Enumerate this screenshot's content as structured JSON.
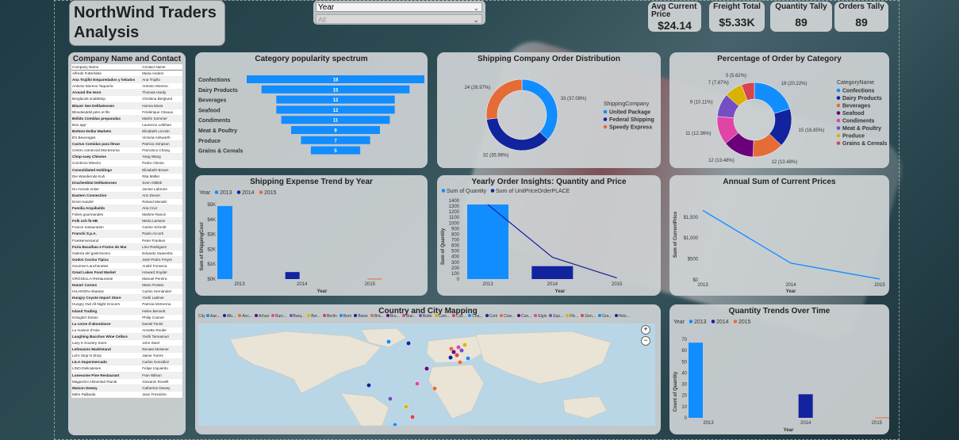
{
  "header": {
    "title": "NorthWind Traders Analysis"
  },
  "slicer": {
    "label": "Year",
    "value": "All"
  },
  "kpis": [
    {
      "title": "Avg Current Price",
      "value": "$24.14"
    },
    {
      "title": "Freight Total",
      "value": "$5.33K"
    },
    {
      "title": "Quantity Tally",
      "value": "89"
    },
    {
      "title": "Orders Tally",
      "value": "89"
    }
  ],
  "company_table": {
    "title": "Company Name and Contact",
    "columns": [
      "Company Name",
      "Contact Name"
    ],
    "rows": [
      [
        "Alfreds Futterkiste",
        "Maria Anders"
      ],
      [
        "Ana Trujillo Emparedados y helados",
        "Ana Trujillo"
      ],
      [
        "Antonio Moreno Taquería",
        "Antonio Moreno"
      ],
      [
        "Around the Horn",
        "Thomas Hardy"
      ],
      [
        "Berglunds snabbköp",
        "Christina Berglund"
      ],
      [
        "Blauer See Delikatessen",
        "Hanna Moos"
      ],
      [
        "Blondesddsl père et fils",
        "Frédérique Citeaux"
      ],
      [
        "Bólido Comidas preparadas",
        "Martín Sommer"
      ],
      [
        "Bon app'",
        "Laurence Lebihan"
      ],
      [
        "Bottom-Dollar Markets",
        "Elizabeth Lincoln"
      ],
      [
        "B's Beverages",
        "Victoria Ashworth"
      ],
      [
        "Cactus Comidas para llevar",
        "Patricio Simpson"
      ],
      [
        "Centro comercial Moctezuma",
        "Francisco Chang"
      ],
      [
        "Chop-suey Chinese",
        "Yang Wang"
      ],
      [
        "Comércio Mineiro",
        "Pedro Afonso"
      ],
      [
        "Consolidated Holdings",
        "Elizabeth Brown"
      ],
      [
        "Die Wandernde Kuh",
        "Rita Müller"
      ],
      [
        "Drachenblut Delikatessen",
        "Sven Ottlieb"
      ],
      [
        "Du monde entier",
        "Janine Labrune"
      ],
      [
        "Eastern Connection",
        "Ann Devon"
      ],
      [
        "Ernst Handel",
        "Roland Mendel"
      ],
      [
        "Familia Arquibaldo",
        "Aria Cruz"
      ],
      [
        "Folies gourmandes",
        "Martine Rancé"
      ],
      [
        "Folk och fä HB",
        "Maria Larsson"
      ],
      [
        "France restauration",
        "Carine Schmitt"
      ],
      [
        "Franchi S.p.A.",
        "Paolo Accorti"
      ],
      [
        "Frankenversand",
        "Peter Franken"
      ],
      [
        "Furia Bacalhau e Frutos do Mar",
        "Lino Rodriguez"
      ],
      [
        "Galería del gastrónomo",
        "Eduardo Saavedra"
      ],
      [
        "Godos Cocina Típica",
        "José Pedro Freyre"
      ],
      [
        "Gourmet Lanchonetes",
        "André Fonseca"
      ],
      [
        "Great Lakes Food Market",
        "Howard Snyder"
      ],
      [
        "GROSELLA-Restaurante",
        "Manuel Pereira"
      ],
      [
        "Hanari Carnes",
        "Mario Pontes"
      ],
      [
        "HILARIÓN-Abastos",
        "Carlos Hernández"
      ],
      [
        "Hungry Coyote Import Store",
        "Yoshi Latimer"
      ],
      [
        "Hungry Owl All-Night Grocers",
        "Patricia McKenna"
      ],
      [
        "Island Trading",
        "Helen Bennett"
      ],
      [
        "Königlich Essen",
        "Philip Cramer"
      ],
      [
        "La corne d'abondance",
        "Daniel Tonini"
      ],
      [
        "La maison d'Asie",
        "Annette Roulet"
      ],
      [
        "Laughing Bacchus Wine Cellars",
        "Yoshi Tannamuri"
      ],
      [
        "Lazy K Kountry Store",
        "John Steel"
      ],
      [
        "Lehmanns Marktstand",
        "Renate Messner"
      ],
      [
        "Let's Stop N Shop",
        "Jaime Yorres"
      ],
      [
        "LILA-Supermercado",
        "Carlos González"
      ],
      [
        "LINO-Delicateses",
        "Felipe Izquierdo"
      ],
      [
        "Lonesome Pine Restaurant",
        "Fran Wilson"
      ],
      [
        "Magazzini Alimentari Riuniti",
        "Giovanni Rovelli"
      ],
      [
        "Maison Dewey",
        "Catherine Dewey"
      ],
      [
        "Mère Paillarde",
        "Jean Fresnière"
      ]
    ]
  },
  "panels": {
    "category_popularity": "Category popularity spectrum",
    "shipping_distribution": "Shipping Company Order Distribution",
    "pct_by_category": "Percentage of Order by Category",
    "shipping_expense": "Shipping Expense Trend by Year",
    "yearly_insights": "Yearly Order Insights: Quantity and Price",
    "annual_prices": "Annual Sum of Current Prices",
    "country_map": "Country and City Mapping",
    "quantity_trends": "Quantity Trends Over Time"
  },
  "map": {
    "legend_title": "City",
    "legend_items": [
      "Aac...",
      "Alb...",
      "Anc...",
      "Árhus",
      "Barc...",
      "Barq...",
      "Ber...",
      "Berlin",
      "Bern",
      "Boise",
      "Brä...",
      "Bru...",
      "Bue...",
      "Butte",
      "Cam...",
      "Car...",
      "Cha...",
      "Cork",
      "Cow...",
      "Cun...",
      "Elgin",
      "Esp...",
      "Fle...",
      "Gen...",
      "Gra...",
      "Hels..."
    ]
  },
  "colors": {
    "blue": "#118DFF",
    "navy": "#12239E",
    "orange": "#E66C37",
    "purple": "#6B007B",
    "pink": "#E044A7",
    "violet": "#744EC2",
    "yellow": "#D9B300",
    "red": "#D64550"
  },
  "chart_data": [
    {
      "type": "bar",
      "orientation": "horizontal",
      "title": "Category popularity spectrum",
      "categories": [
        "Confections",
        "Dairy Products",
        "Beverages",
        "Seafood",
        "Condiments",
        "Meat & Poultry",
        "Produce",
        "Grains & Cereals"
      ],
      "values": [
        18,
        15,
        12,
        12,
        11,
        9,
        7,
        5
      ]
    },
    {
      "type": "pie",
      "subtype": "donut",
      "title": "Shipping Company Order Distribution",
      "legend_title": "ShippingCompany",
      "categories": [
        "United Package",
        "Federal Shipping",
        "Speedy Express"
      ],
      "values": [
        33,
        32,
        24
      ],
      "labels": [
        "33 (37.08%)",
        "32 (35.96%)",
        "24 (26.97%)"
      ],
      "colors": [
        "#118DFF",
        "#12239E",
        "#E66C37"
      ]
    },
    {
      "type": "pie",
      "subtype": "donut",
      "title": "Percentage of Order by Category",
      "legend_title": "CategoryName",
      "categories": [
        "Confections",
        "Dairy Products",
        "Beverages",
        "Seafood",
        "Condiments",
        "Meat & Poultry",
        "Produce",
        "Grains & Cereals"
      ],
      "values": [
        18,
        15,
        12,
        12,
        11,
        9,
        7,
        5
      ],
      "labels": [
        "18 (20.22%)",
        "15 (16.85%)",
        "12 (13.48%)",
        "12 (13.48%)",
        "11 (12.36%)",
        "9 (10.11%)",
        "7 (7.87%)",
        "5 (5.62%)"
      ],
      "colors": [
        "#118DFF",
        "#12239E",
        "#E66C37",
        "#6B007B",
        "#E044A7",
        "#744EC2",
        "#D9B300",
        "#D64550"
      ]
    },
    {
      "type": "bar",
      "title": "Shipping Expense Trend by Year",
      "legend_title": "Year",
      "xlabel": "Year",
      "ylabel": "Sum of ShippingCost",
      "categories": [
        "2013",
        "2014",
        "2015"
      ],
      "series": [
        {
          "name": "2013",
          "values": [
            4900,
            0,
            0
          ]
        },
        {
          "name": "2014",
          "values": [
            0,
            470,
            0
          ]
        },
        {
          "name": "2015",
          "values": [
            0,
            0,
            0
          ]
        }
      ],
      "yticks": [
        "$0K",
        "$1K",
        "$2K",
        "$3K",
        "$4K",
        "$5K"
      ],
      "ylim": [
        0,
        5000
      ]
    },
    {
      "type": "bar",
      "subtype": "combo",
      "title": "Yearly Order Insights: Quantity and Price",
      "xlabel": "Year",
      "ylabel": "Sum of Quantity",
      "categories": [
        "2013",
        "2014",
        "2015"
      ],
      "series": [
        {
          "name": "Sum of Quantity",
          "type": "bar",
          "values": [
            1330,
            230,
            0
          ]
        },
        {
          "name": "Sum of UnitPriceOrderPLACE",
          "type": "line",
          "values": [
            1330,
            390,
            20
          ]
        }
      ],
      "yticks": [
        "0",
        "100",
        "200",
        "300",
        "400",
        "500",
        "600",
        "700",
        "800",
        "900",
        "1000",
        "1100",
        "1200",
        "1300",
        "1400"
      ],
      "ylim": [
        0,
        1400
      ]
    },
    {
      "type": "line",
      "title": "Annual Sum of Current Prices",
      "xlabel": "Year",
      "ylabel": "Sum of CurrentPrice",
      "categories": [
        "2013",
        "2014",
        "2015"
      ],
      "series": [
        {
          "name": "Sum of CurrentPrice",
          "values": [
            1660,
            400,
            20
          ]
        }
      ],
      "yticks": [
        "$0",
        "$500",
        "$1,000",
        "$1,500"
      ],
      "ylim": [
        0,
        1800
      ]
    },
    {
      "type": "bar",
      "title": "Quantity Trends Over Time",
      "legend_title": "Year",
      "xlabel": "Year",
      "ylabel": "Count of Quantity",
      "categories": [
        "2013",
        "2014",
        "2015"
      ],
      "series": [
        {
          "name": "2013",
          "values": [
            67,
            0,
            0
          ]
        },
        {
          "name": "2014",
          "values": [
            0,
            21,
            0
          ]
        },
        {
          "name": "2015",
          "values": [
            0,
            0,
            0
          ]
        }
      ],
      "yticks": [
        "0",
        "10",
        "20",
        "30",
        "40",
        "50",
        "60",
        "70"
      ],
      "ylim": [
        0,
        72
      ]
    }
  ]
}
